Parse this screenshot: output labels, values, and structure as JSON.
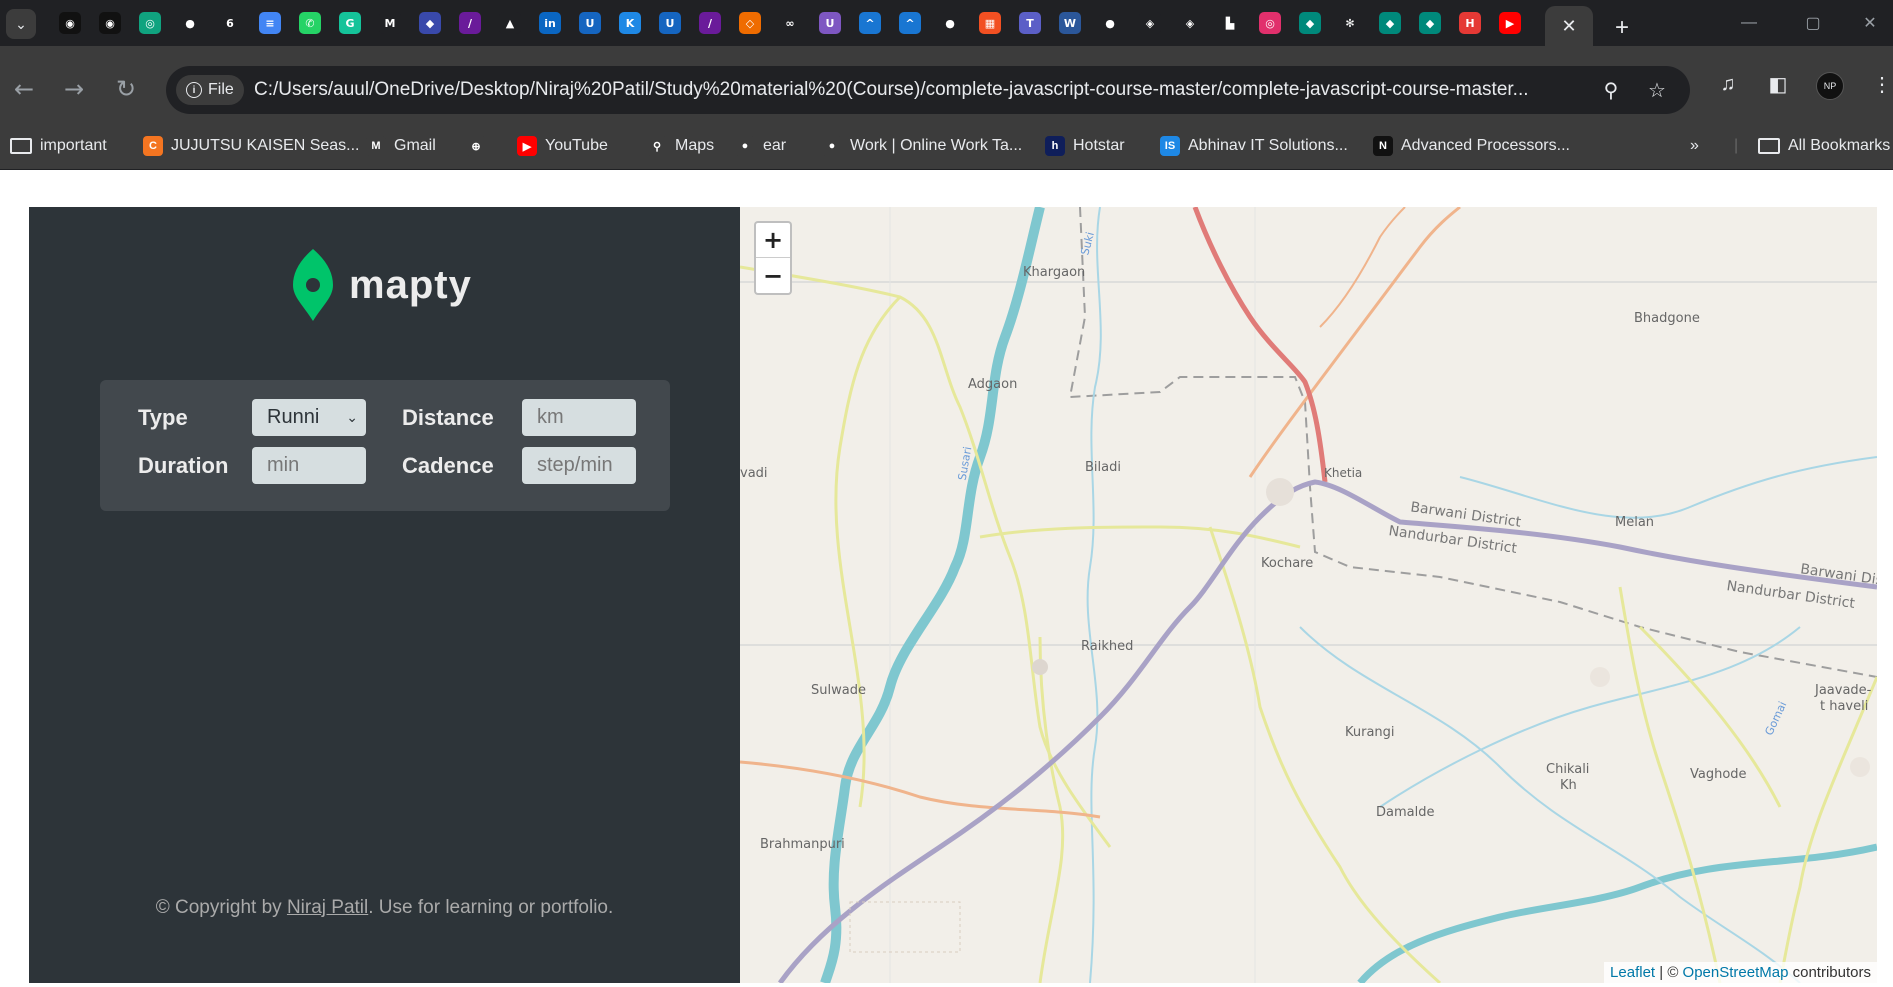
{
  "browser": {
    "tab_close": "✕",
    "new_tab": "+",
    "tab_favicons": [
      {
        "name": "favicon-1-icon",
        "glyph": "◉",
        "bg": "#111"
      },
      {
        "name": "favicon-2-icon",
        "glyph": "◉",
        "bg": "#111"
      },
      {
        "name": "chatgpt-icon",
        "glyph": "◎",
        "bg": "#10a37f"
      },
      {
        "name": "github-icon",
        "glyph": "●",
        "bg": "#202124"
      },
      {
        "name": "favicon-6-icon",
        "glyph": "6",
        "bg": "#202124"
      },
      {
        "name": "docs-icon",
        "glyph": "≡",
        "bg": "#4285f4"
      },
      {
        "name": "whatsapp-icon",
        "glyph": "✆",
        "bg": "#25d366"
      },
      {
        "name": "grammarly-icon",
        "glyph": "G",
        "bg": "#15c39a"
      },
      {
        "name": "gmail-icon",
        "glyph": "M",
        "bg": "#202124"
      },
      {
        "name": "favicon-10-icon",
        "glyph": "◆",
        "bg": "#3949ab"
      },
      {
        "name": "favicon-11-icon",
        "glyph": "∕",
        "bg": "#6a1b9a"
      },
      {
        "name": "drive-icon",
        "glyph": "▲",
        "bg": "#202124"
      },
      {
        "name": "linkedin-icon",
        "glyph": "in",
        "bg": "#0a66c2"
      },
      {
        "name": "favicon-14-icon",
        "glyph": "U",
        "bg": "#1565c0"
      },
      {
        "name": "favicon-15-icon",
        "glyph": "K",
        "bg": "#1e88e5"
      },
      {
        "name": "favicon-16-icon",
        "glyph": "U",
        "bg": "#1565c0"
      },
      {
        "name": "favicon-17-icon",
        "glyph": "∕",
        "bg": "#6a1b9a"
      },
      {
        "name": "favicon-18-icon",
        "glyph": "◇",
        "bg": "#ef6c00"
      },
      {
        "name": "favicon-19-icon",
        "glyph": "∞",
        "bg": "#202124"
      },
      {
        "name": "favicon-20-icon",
        "glyph": "U",
        "bg": "#7e57c2"
      },
      {
        "name": "favicon-21-icon",
        "glyph": "^",
        "bg": "#1976d2"
      },
      {
        "name": "favicon-22-icon",
        "glyph": "^",
        "bg": "#1976d2"
      },
      {
        "name": "github-icon-2",
        "glyph": "●",
        "bg": "#202124"
      },
      {
        "name": "microsoft-icon",
        "glyph": "▦",
        "bg": "#f25022"
      },
      {
        "name": "teams-icon",
        "glyph": "T",
        "bg": "#5b5fc7"
      },
      {
        "name": "word-icon",
        "glyph": "W",
        "bg": "#2b579a"
      },
      {
        "name": "github-icon-3",
        "glyph": "●",
        "bg": "#202124"
      },
      {
        "name": "codepen-icon",
        "glyph": "◈",
        "bg": "#202124"
      },
      {
        "name": "codepen-icon-2",
        "glyph": "◈",
        "bg": "#202124"
      },
      {
        "name": "favicon-30-icon",
        "glyph": "▙",
        "bg": "#202124"
      },
      {
        "name": "instagram-icon",
        "glyph": "◎",
        "bg": "#e1306c"
      },
      {
        "name": "favicon-32-icon",
        "glyph": "◆",
        "bg": "#00897b"
      },
      {
        "name": "favicon-33-icon",
        "glyph": "✻",
        "bg": "#202124"
      },
      {
        "name": "favicon-34-icon",
        "glyph": "◆",
        "bg": "#00897b"
      },
      {
        "name": "favicon-35-icon",
        "glyph": "◆",
        "bg": "#00897b"
      },
      {
        "name": "favicon-36-icon",
        "glyph": "H",
        "bg": "#e53935"
      },
      {
        "name": "youtube-icon",
        "glyph": "▶",
        "bg": "#ff0000"
      },
      {
        "name": "github-icon-4",
        "glyph": "●",
        "bg": "#202124"
      }
    ],
    "address": {
      "chip_label": "File",
      "url": "C:/Users/auul/OneDrive/Desktop/Niraj%20Patil/Study%20material%20(Course)/complete-javascript-course-master/complete-javascript-course-master..."
    },
    "profile_initials": "NP",
    "bookmarks": [
      {
        "label": "important",
        "type": "folder"
      },
      {
        "label": "JUJUTSU KAISEN Seas...",
        "icon_bg": "#f47521",
        "glyph": "C"
      },
      {
        "label": "Gmail",
        "icon_bg": "#3c3c3c",
        "glyph": "M"
      },
      {
        "label": "",
        "icon_bg": "#3c3c3c",
        "glyph": "⊕"
      },
      {
        "label": "YouTube",
        "icon_bg": "#ff0000",
        "glyph": "▶"
      },
      {
        "label": "Maps",
        "icon_bg": "#3c3c3c",
        "glyph": "⚲"
      },
      {
        "label": "ear",
        "icon_bg": "#3c3c3c",
        "glyph": "●"
      },
      {
        "label": "Work | Online Work Ta...",
        "icon_bg": "#3c3c3c",
        "glyph": "●"
      },
      {
        "label": "Hotstar",
        "icon_bg": "#0f1e5a",
        "glyph": "h"
      },
      {
        "label": "Abhinav IT Solutions...",
        "icon_bg": "#1e88e5",
        "glyph": "IS"
      },
      {
        "label": "Advanced Processors...",
        "icon_bg": "#111",
        "glyph": "N"
      }
    ],
    "bookmarks_overflow": "»",
    "all_bookmarks": "All Bookmarks"
  },
  "app": {
    "logo_text": "mapty",
    "form": {
      "type_label": "Type",
      "type_value": "Runni",
      "distance_label": "Distance",
      "distance_placeholder": "km",
      "duration_label": "Duration",
      "duration_placeholder": "min",
      "cadence_label": "Cadence",
      "cadence_placeholder": "step/min"
    },
    "copyright": {
      "prefix": "© Copyright by ",
      "author": "Niraj Patil",
      "suffix": ". Use for learning or portfolio."
    },
    "accent_color": "#00c46a"
  },
  "map": {
    "zoom_in": "+",
    "zoom_out": "−",
    "attribution": {
      "leaflet": "Leaflet",
      "sep": " | © ",
      "osm": "OpenStreetMap",
      "suffix": " contributors"
    },
    "labels": {
      "khargaon": "Khargaon",
      "bhadgone": "Bhadgone",
      "adgaon": "Adgaon",
      "biladi": "Biladi",
      "khetia": "Khetia",
      "barwani_1": "Barwani District",
      "nandurbar_1": "Nandurbar District",
      "melan": "Melan",
      "barwani_2": "Barwani Dis",
      "nandurbar_2": "Nandurbar District",
      "kochare": "Kochare",
      "raikhed": "Raikhed",
      "sulwade": "Sulwade",
      "kurangi": "Kurangi",
      "chikali": "Chikali",
      "kh": "Kh",
      "vaghode": "Vaghode",
      "damalde": "Damalde",
      "jaavade": "Jaavade-",
      "thaveli": "t haveli",
      "brahmanpuri": "Brahmanpuri",
      "vadi": "vadi",
      "suki": "Suki",
      "susari": "Susari",
      "gomai": "Gomai"
    }
  }
}
